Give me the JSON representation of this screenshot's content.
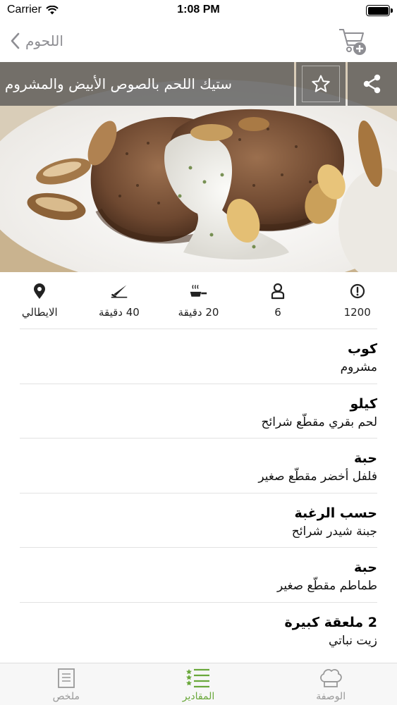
{
  "status_bar": {
    "carrier": "Carrier",
    "time": "1:08 PM"
  },
  "nav": {
    "back_label": "اللحوم"
  },
  "hero": {
    "title": "ستيك اللحم بالصوص الأبيض والمشروم"
  },
  "info": [
    {
      "icon": "alert-circle-icon",
      "value": "1200"
    },
    {
      "icon": "person-icon",
      "value": "6"
    },
    {
      "icon": "frying-pan-icon",
      "value": "20 دقيقة"
    },
    {
      "icon": "knife-icon",
      "value": "40 دقيقة"
    },
    {
      "icon": "location-pin-icon",
      "value": "الايطالي"
    }
  ],
  "ingredients": [
    {
      "qty": "كوب",
      "name": "مشروم"
    },
    {
      "qty": "كيلو",
      "name": "لحم بقري مقطّع شرائح"
    },
    {
      "qty": "حبة",
      "name": "فلفل أخضر مقطّع صغير"
    },
    {
      "qty": "حسب الرغبة",
      "name": "جبنة شيدر شرائح"
    },
    {
      "qty": "حبة",
      "name": "طماطم مقطّع صغير"
    },
    {
      "qty": "2 ملعقة كبيرة",
      "name": "زيت نباتي"
    }
  ],
  "tabs": {
    "recipe": "الوصفة",
    "ingredients": "المقادير",
    "summary": "ملخص",
    "active": "ingredients"
  },
  "colors": {
    "accent": "#6aa83b",
    "muted": "#8e8e93"
  }
}
